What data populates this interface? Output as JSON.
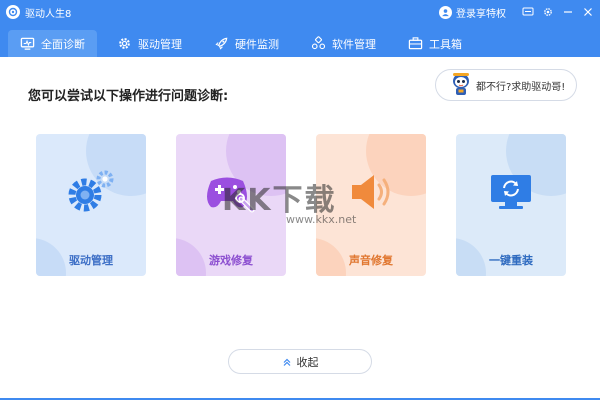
{
  "window": {
    "title": "驱动人生8",
    "login_text": "登录享特权"
  },
  "tabs": [
    {
      "label": "全面诊断",
      "icon": "monitor-icon",
      "active": true
    },
    {
      "label": "驱动管理",
      "icon": "gear-icon",
      "active": false
    },
    {
      "label": "硬件监测",
      "icon": "rocket-icon",
      "active": false
    },
    {
      "label": "软件管理",
      "icon": "apps-icon",
      "active": false
    },
    {
      "label": "工具箱",
      "icon": "toolbox-icon",
      "active": false
    }
  ],
  "main": {
    "prompt": "您可以尝试以下操作进行问题诊断:",
    "help_button": "都不行?求助驱动哥!",
    "cards": [
      {
        "label": "驱动管理",
        "icon": "gears-icon"
      },
      {
        "label": "游戏修复",
        "icon": "gamepad-wrench-icon"
      },
      {
        "label": "声音修复",
        "icon": "speaker-icon"
      },
      {
        "label": "一键重装",
        "icon": "monitor-refresh-icon"
      }
    ],
    "collapse_button": "收起"
  },
  "watermark": {
    "big": "KK下载",
    "small": "www.kkx.net"
  },
  "colors": {
    "accent": "#3f8af0",
    "driver_card": "#dbe9fb",
    "game_card": "#ead8f7",
    "sound_card": "#fde4d6",
    "reinstall_card": "#dceaf9"
  }
}
